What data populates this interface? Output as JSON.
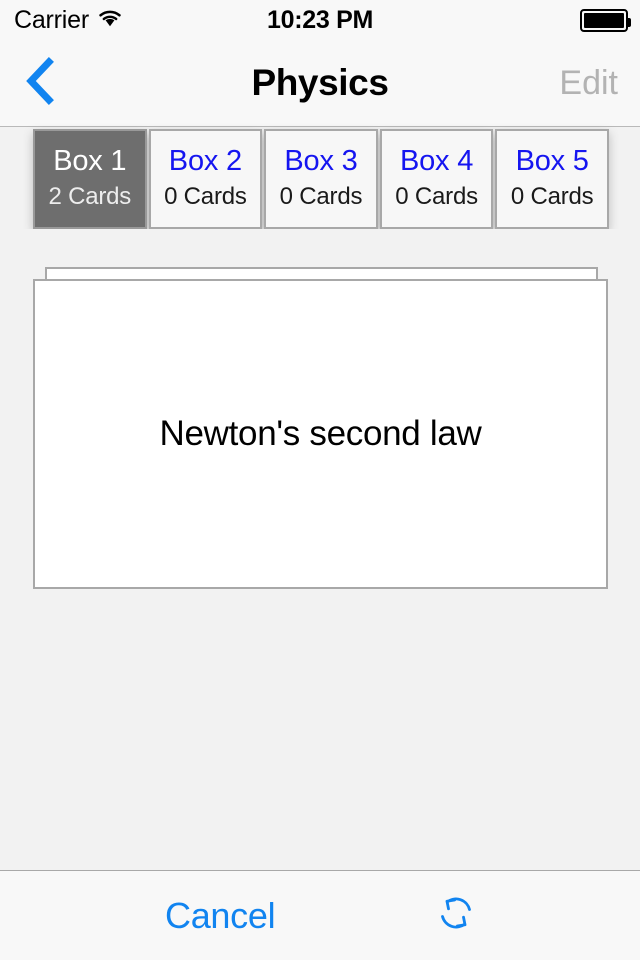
{
  "status_bar": {
    "carrier": "Carrier",
    "wifi_icon": "wifi-icon",
    "time": "10:23 PM",
    "battery_icon": "battery-full-icon"
  },
  "nav_bar": {
    "back_icon": "chevron-left-icon",
    "title": "Physics",
    "edit_label": "Edit",
    "edit_enabled": false
  },
  "box_selector": {
    "boxes": [
      {
        "title": "Box 1",
        "count_label": "2 Cards",
        "card_count": 2,
        "selected": true
      },
      {
        "title": "Box 2",
        "count_label": "0 Cards",
        "card_count": 0,
        "selected": false
      },
      {
        "title": "Box 3",
        "count_label": "0 Cards",
        "card_count": 0,
        "selected": false
      },
      {
        "title": "Box 4",
        "count_label": "0 Cards",
        "card_count": 0,
        "selected": false
      },
      {
        "title": "Box 5",
        "count_label": "0 Cards",
        "card_count": 0,
        "selected": false
      }
    ]
  },
  "card_stack": {
    "front_card_text": "Newton's second law",
    "cards_behind": 1
  },
  "toolbar": {
    "cancel_label": "Cancel",
    "refresh_icon": "refresh-icon"
  },
  "colors": {
    "tint_blue": "#1184f0",
    "box_link_blue": "#1515f0",
    "selected_box_bg": "#6e6e6e",
    "disabled_gray": "#b3b3b3",
    "page_bg": "#f2f2f2",
    "bar_bg": "#f8f8f8",
    "border_gray": "#a8a8a8"
  }
}
